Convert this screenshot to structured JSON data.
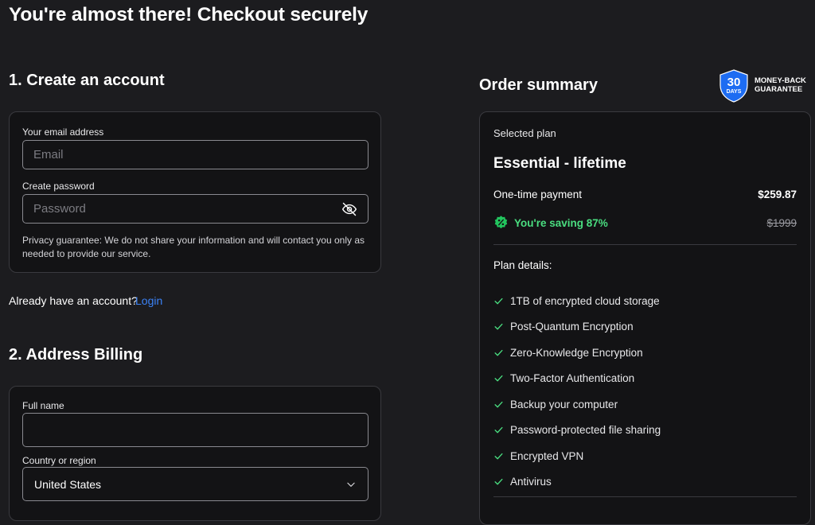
{
  "page": {
    "title": "You're almost there! Checkout securely"
  },
  "account": {
    "section_title": "1. Create an account",
    "email_label": "Your email address",
    "email_placeholder": "Email",
    "password_label": "Create password",
    "password_placeholder": "Password",
    "privacy_text": "Privacy guarantee: We do not share your information and will contact you only as needed to provide our service.",
    "login_prompt": "Already have an account?",
    "login_link": "Login"
  },
  "billing": {
    "section_title": "2. Address Billing",
    "fullname_label": "Full name",
    "fullname_value": "",
    "country_label": "Country or region",
    "country_value": "United States"
  },
  "summary": {
    "title": "Order summary",
    "badge_number": "30",
    "badge_unit": "DAYS",
    "badge_line1": "MONEY-BACK",
    "badge_line2": "GUARANTEE",
    "selected_plan_label": "Selected plan",
    "plan_name": "Essential - lifetime",
    "payment_label": "One-time payment",
    "price": "$259.87",
    "saving_text": "You're saving 87%",
    "original_price": "$1999",
    "plan_details_label": "Plan details:",
    "features": [
      "1TB of encrypted cloud storage",
      "Post-Quantum Encryption",
      "Zero-Knowledge Encryption",
      "Two-Factor Authentication",
      "Backup your computer",
      "Password-protected file sharing",
      "Encrypted VPN",
      "Antivirus"
    ]
  },
  "colors": {
    "background": "#1c1c1f",
    "card": "#131315",
    "accent_link": "#3b82f6",
    "success": "#4ade80",
    "badge_blue": "#1d6cf2"
  },
  "icons": {
    "password_toggle": "eye-off-icon",
    "country_dropdown": "chevron-down-icon",
    "saving": "discount-badge-icon",
    "feature": "check-icon",
    "guarantee": "shield-icon"
  }
}
